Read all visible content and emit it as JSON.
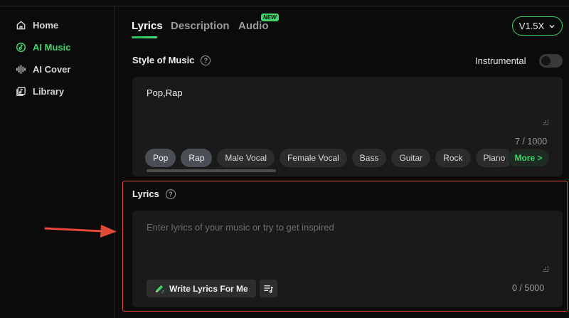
{
  "sidebar": {
    "items": [
      {
        "label": "Home",
        "icon": "home-icon",
        "active": false
      },
      {
        "label": "AI Music",
        "icon": "music-disc-icon",
        "active": true
      },
      {
        "label": "AI Cover",
        "icon": "waveform-icon",
        "active": false
      },
      {
        "label": "Library",
        "icon": "library-icon",
        "active": false
      }
    ]
  },
  "tabs": [
    {
      "label": "Lyrics",
      "active": true
    },
    {
      "label": "Description",
      "active": false
    },
    {
      "label": "Audio",
      "active": false,
      "badge": "NEW"
    }
  ],
  "version": {
    "label": "V1.5X"
  },
  "style": {
    "label": "Style of Music",
    "value": "Pop,Rap",
    "counter": "7 / 1000",
    "chips": [
      {
        "label": "Pop",
        "selected": true
      },
      {
        "label": "Rap",
        "selected": true
      },
      {
        "label": "Male Vocal",
        "selected": false
      },
      {
        "label": "Female Vocal",
        "selected": false
      },
      {
        "label": "Bass",
        "selected": false
      },
      {
        "label": "Guitar",
        "selected": false
      },
      {
        "label": "Rock",
        "selected": false
      },
      {
        "label": "Piano",
        "selected": false
      }
    ],
    "more_label": "More >"
  },
  "instrumental": {
    "label": "Instrumental",
    "on": false
  },
  "lyrics": {
    "label": "Lyrics",
    "placeholder": "Enter lyrics of your music or try to get inspired",
    "counter": "0 / 5000",
    "write_label": "Write Lyrics For Me"
  },
  "colors": {
    "accent": "#3fd56b",
    "highlight": "#e24a37"
  }
}
